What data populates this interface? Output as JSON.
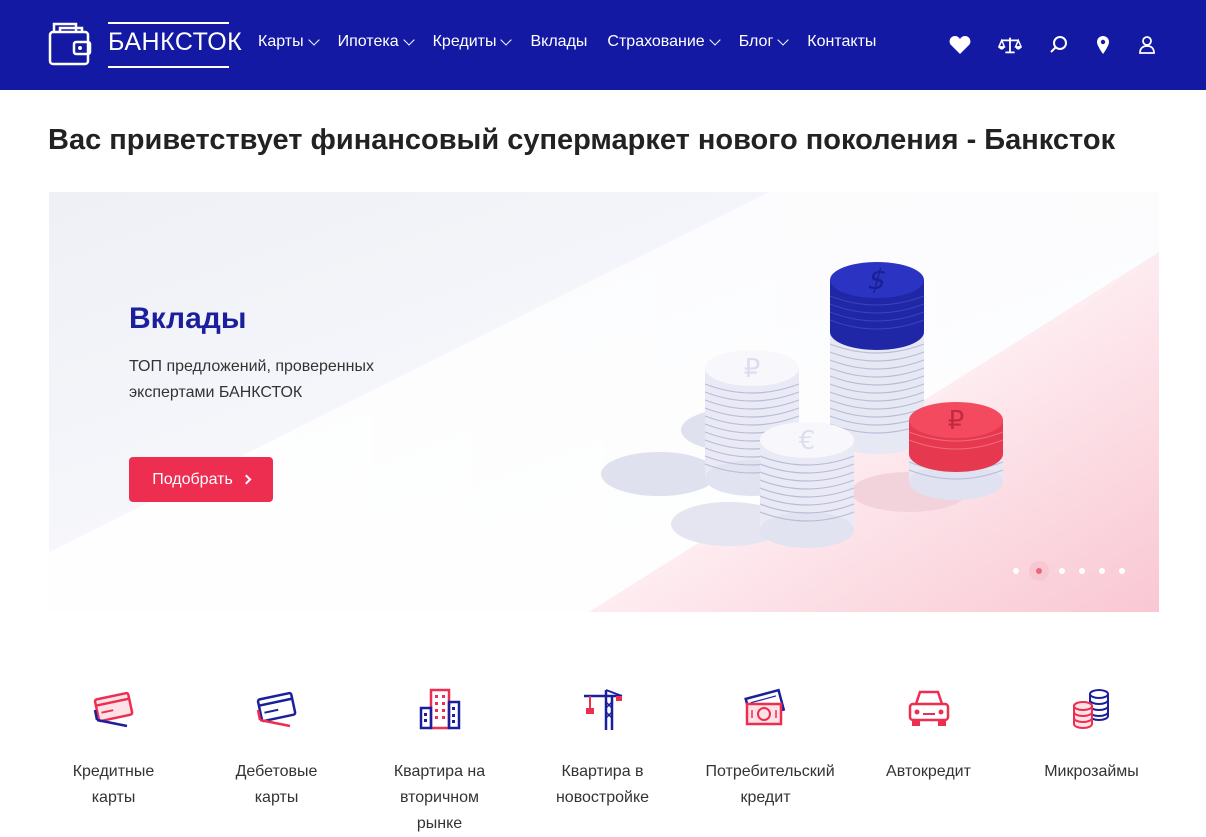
{
  "header": {
    "logo_text": "БАНКСТОК",
    "nav": [
      {
        "label": "Карты",
        "dropdown": true
      },
      {
        "label": "Ипотека",
        "dropdown": true
      },
      {
        "label": "Кредиты",
        "dropdown": true
      },
      {
        "label": "Вклады",
        "dropdown": false
      },
      {
        "label": "Страхование",
        "dropdown": true
      },
      {
        "label": "Блог",
        "dropdown": true
      },
      {
        "label": "Контакты",
        "dropdown": false
      }
    ],
    "tools": [
      "heart-icon",
      "scales-icon",
      "search-icon",
      "location-pin-icon",
      "user-icon"
    ]
  },
  "page_title": "Вас приветствует финансовый супермаркет нового поколения - Банксток",
  "banner": {
    "heading": "Вклады",
    "subtitle": "ТОП предложений, проверенных экспертами БАНКСТОК",
    "button_label": "Подобрать",
    "slides_count": 6,
    "active_slide": 2
  },
  "categories": [
    {
      "label": "Кредитные карты",
      "icon": "credit-card-icon"
    },
    {
      "label": "Дебетовые карты",
      "icon": "debit-card-icon"
    },
    {
      "label": "Квартира на вторичном рынке",
      "icon": "building-icon"
    },
    {
      "label": "Квартира в новостройке",
      "icon": "crane-icon"
    },
    {
      "label": "Потребительский кредит",
      "icon": "cash-icon"
    },
    {
      "label": "Автокредит",
      "icon": "car-icon"
    },
    {
      "label": "Микрозаймы",
      "icon": "coins-icon"
    }
  ],
  "colors": {
    "header_bg": "#1419a3",
    "accent": "#ee2e50",
    "heading_blue": "#1b1f9c"
  }
}
